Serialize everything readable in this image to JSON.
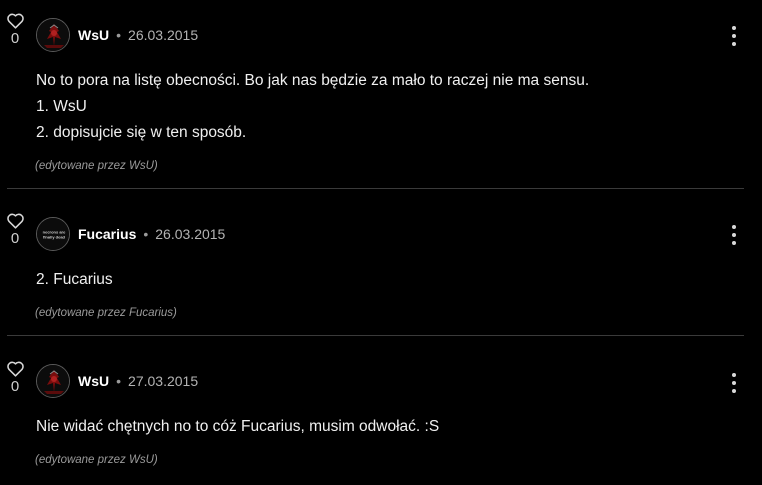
{
  "posts": [
    {
      "like_count": "0",
      "author": "WsU",
      "separator": "•",
      "date": "26.03.2015",
      "body": [
        "No to pora na listę obecności. Bo jak nas będzie za mało to raczej nie ma sensu.",
        "1. WsU",
        "2. dopisujcie się w ten sposób."
      ],
      "edited_note": "(edytowane przez WsU)"
    },
    {
      "like_count": "0",
      "author": "Fucarius",
      "separator": "•",
      "date": "26.03.2015",
      "avatar_text": [
        "necrons are",
        "finally dead"
      ],
      "body": [
        "2. Fucarius"
      ],
      "edited_note": "(edytowane przez Fucarius)"
    },
    {
      "like_count": "0",
      "author": "WsU",
      "separator": "•",
      "date": "27.03.2015",
      "body": [
        "Nie widać chętnych no to cóż Fucarius, musim odwołać. :S"
      ],
      "edited_note": "(edytowane przez WsU)"
    }
  ],
  "icons": {
    "like": "heart-outline-icon",
    "menu": "kebab-menu-icon"
  },
  "colors": {
    "background": "#000000",
    "text": "#f0f0f0",
    "meta": "#b3b3b3",
    "divider": "#3a3a3a"
  }
}
